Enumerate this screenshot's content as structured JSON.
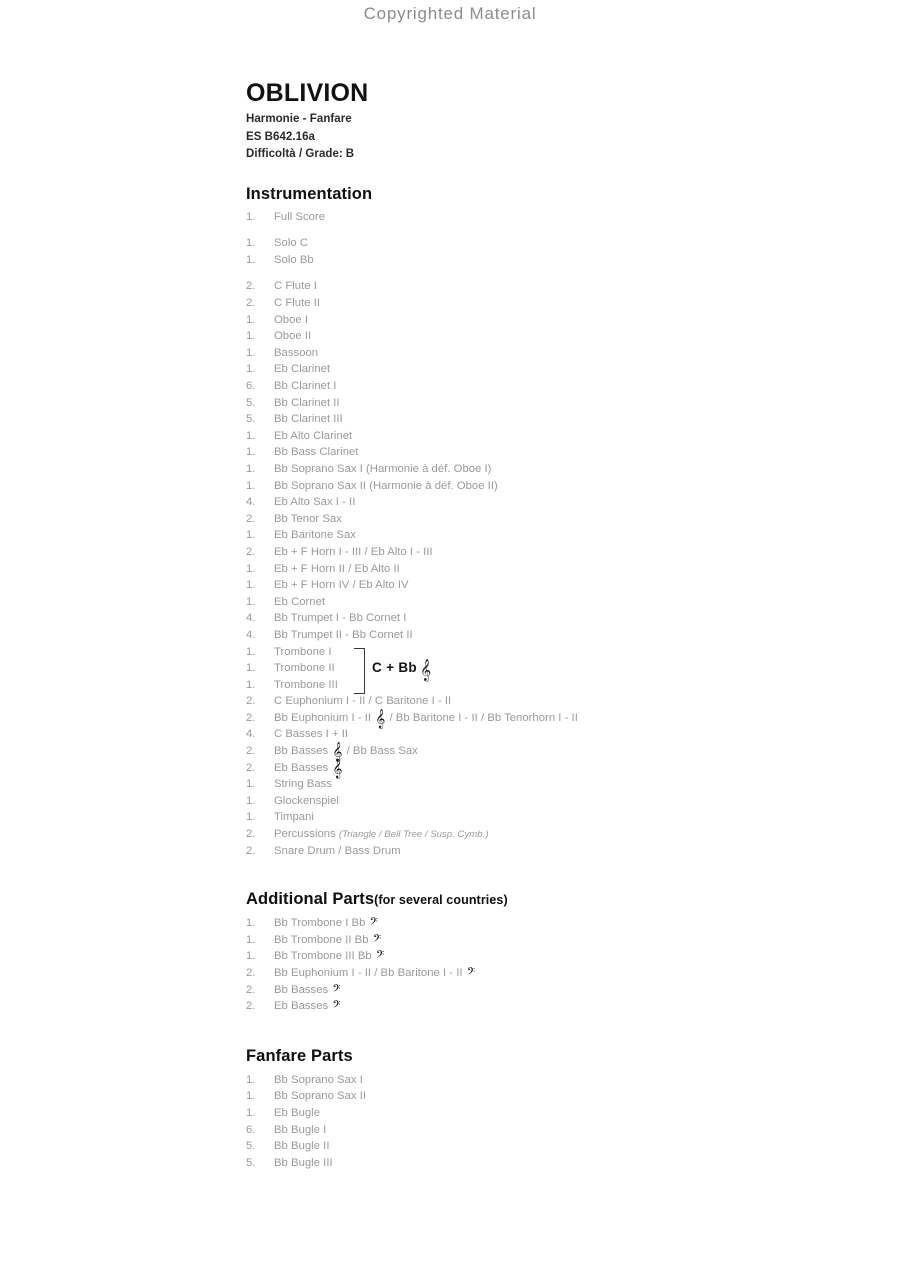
{
  "page": {
    "copyright_banner": "Copyrighted Material"
  },
  "header": {
    "title": "OBLIVION",
    "series": "Harmonie - Fanfare",
    "catalog": "ES B642.16a",
    "grade_label": "Difficoltà / Grade:",
    "grade_value": "B"
  },
  "sections": {
    "instrumentation": {
      "heading": "Instrumentation",
      "groups": [
        {
          "rows": [
            {
              "qty": "1.",
              "label": "Full Score"
            }
          ]
        },
        {
          "rows": [
            {
              "qty": "1.",
              "label": "Solo C"
            },
            {
              "qty": "1.",
              "label": "Solo Bb"
            }
          ]
        },
        {
          "rows": [
            {
              "qty": "2.",
              "label": "C Flute I"
            },
            {
              "qty": "2.",
              "label": "C Flute II"
            },
            {
              "qty": "1.",
              "label": "Oboe I"
            },
            {
              "qty": "1.",
              "label": "Oboe II"
            },
            {
              "qty": "1.",
              "label": "Bassoon"
            },
            {
              "qty": "1.",
              "label": "Eb Clarinet"
            },
            {
              "qty": "6.",
              "label": "Bb Clarinet I"
            },
            {
              "qty": "5.",
              "label": "Bb Clarinet II"
            },
            {
              "qty": "5.",
              "label": "Bb Clarinet III"
            },
            {
              "qty": "1.",
              "label": "Eb Alto Clarinet"
            },
            {
              "qty": "1.",
              "label": "Bb Bass Clarinet"
            },
            {
              "qty": "1.",
              "label": "Bb Soprano Sax I (Harmonie à déf. Oboe I)"
            },
            {
              "qty": "1.",
              "label": "Bb Soprano Sax II (Harmonie à déf. Oboe II)"
            },
            {
              "qty": "4.",
              "label": "Eb Alto Sax I - II"
            },
            {
              "qty": "2.",
              "label": "Bb Tenor Sax"
            },
            {
              "qty": "1.",
              "label": "Eb Baritone Sax"
            },
            {
              "qty": "2.",
              "label": "Eb + F Horn I - III / Eb Alto I - III"
            },
            {
              "qty": "1.",
              "label": "Eb + F Horn II / Eb Alto II"
            },
            {
              "qty": "1.",
              "label": "Eb + F Horn IV / Eb Alto IV"
            },
            {
              "qty": "1.",
              "label": "Eb Cornet"
            },
            {
              "qty": "4.",
              "label": "Bb Trumpet I - Bb Cornet I"
            },
            {
              "qty": "4.",
              "label": "Bb Trumpet II - Bb Cornet II"
            }
          ]
        }
      ],
      "trombone_group": {
        "rows": [
          {
            "qty": "1.",
            "label": "Trombone I"
          },
          {
            "qty": "1.",
            "label": "Trombone II"
          },
          {
            "qty": "1.",
            "label": "Trombone III"
          }
        ],
        "bracket_note": "C + Bb",
        "bracket_clef": "𝄞"
      },
      "tail_rows": [
        {
          "qty": "2.",
          "label": "C Euphonium I - II / C Baritone I - II"
        },
        {
          "qty": "2.",
          "label_before": "Bb Euphonium I - II",
          "clef": "𝄞",
          "label_after": "/ Bb Baritone  I - II / Bb Tenorhorn I - II"
        },
        {
          "qty": "4.",
          "label": "C Basses I + II"
        },
        {
          "qty": "2.",
          "label_before": "Bb Basses",
          "clef": "𝄞",
          "label_after": "/ Bb Bass Sax"
        },
        {
          "qty": "2.",
          "label_before": "Eb Basses",
          "clef": "𝄞",
          "label_after": ""
        },
        {
          "qty": "1.",
          "label": "String Bass"
        },
        {
          "qty": "1.",
          "label": "Glockenspiel"
        },
        {
          "qty": "1.",
          "label": "Timpani"
        },
        {
          "qty": "2.",
          "label_before": "Percussions",
          "italic": "(Triangle / Bell Tree / Susp. Cymb.)"
        },
        {
          "qty": "2.",
          "label": "Snare Drum / Bass Drum"
        }
      ]
    },
    "additional_parts": {
      "heading": "Additional Parts",
      "heading_suffix": "(for several countries)",
      "rows": [
        {
          "qty": "1.",
          "label_before": "Bb Trombone I Bb",
          "clef": "𝄢",
          "label_after": ""
        },
        {
          "qty": "1.",
          "label_before": "Bb Trombone II Bb",
          "clef": "𝄢",
          "label_after": ""
        },
        {
          "qty": "1.",
          "label_before": "Bb Trombone III Bb",
          "clef": "𝄢",
          "label_after": ""
        },
        {
          "qty": "2.",
          "label_before": "Bb Euphonium I - II / Bb Baritone I - II",
          "clef": "𝄢",
          "label_after": ""
        },
        {
          "qty": "2.",
          "label_before": "Bb Basses",
          "clef": "𝄢",
          "label_after": ""
        },
        {
          "qty": "2.",
          "label_before": "Eb Basses",
          "clef": "𝄢",
          "label_after": ""
        }
      ]
    },
    "fanfare_parts": {
      "heading": "Fanfare Parts",
      "rows": [
        {
          "qty": "1.",
          "label": "Bb Soprano Sax I"
        },
        {
          "qty": "1.",
          "label": "Bb Soprano Sax II"
        },
        {
          "qty": "1.",
          "label": "Eb Bugle"
        },
        {
          "qty": "6.",
          "label": "Bb Bugle I"
        },
        {
          "qty": "5.",
          "label": "Bb Bugle II"
        },
        {
          "qty": "5.",
          "label": "Bb Bugle III"
        }
      ]
    }
  },
  "colors": {
    "page_bg": "#ffffff",
    "heading_text": "#101010",
    "list_text": "#9a9a9a",
    "banner_text": "#8c8c8c"
  }
}
